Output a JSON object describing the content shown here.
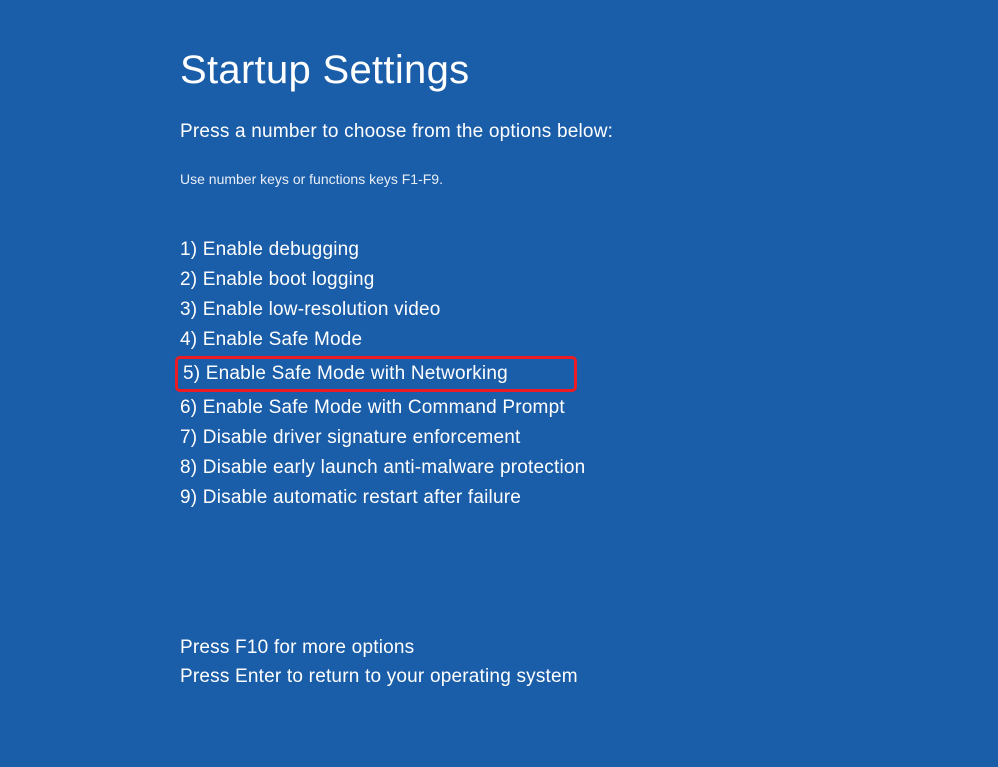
{
  "title": "Startup Settings",
  "subtitle": "Press a number to choose from the options below:",
  "hint": "Use number keys or functions keys F1-F9.",
  "options": [
    "1) Enable debugging",
    "2) Enable boot logging",
    "3) Enable low-resolution video",
    "4) Enable Safe Mode",
    "5) Enable Safe Mode with Networking",
    "6) Enable Safe Mode with Command Prompt",
    "7) Disable driver signature enforcement",
    "8) Disable early launch anti-malware protection",
    "9) Disable automatic restart after failure"
  ],
  "footer": {
    "more_options": "Press F10 for more options",
    "return": "Press Enter to return to your operating system"
  },
  "highlight_index": 4,
  "colors": {
    "background": "#1a5da8",
    "text": "#ffffff",
    "highlight_border": "#ed1c24"
  }
}
